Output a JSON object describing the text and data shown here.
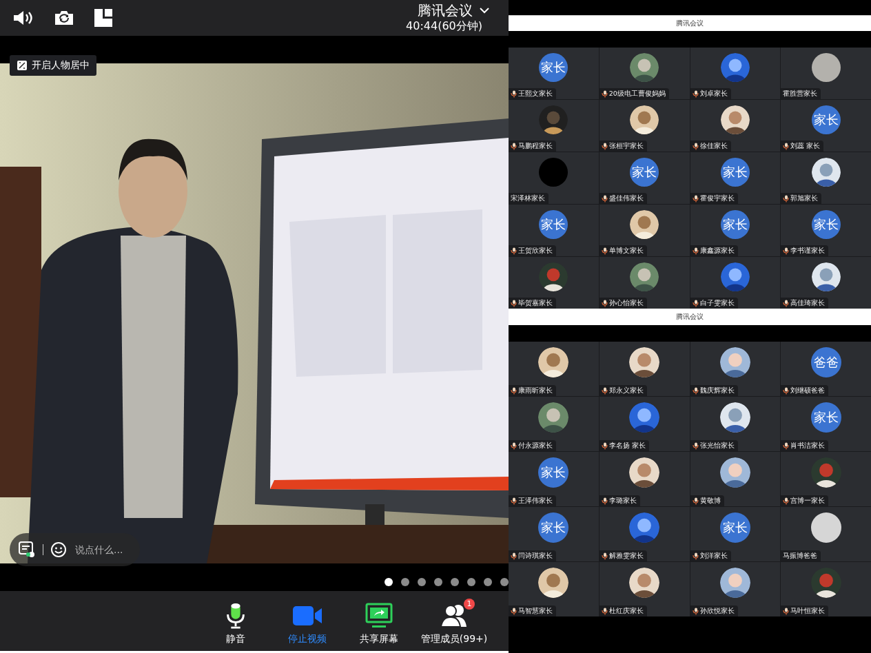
{
  "meeting": {
    "title": "腾讯会议",
    "timer": "40:44(60分钟)"
  },
  "video": {
    "kind": "picture",
    "center_button": "开启人物居中",
    "chat_placeholder": "说点什么...",
    "pages": [
      {
        "selected": true
      },
      {
        "selected": false
      },
      {
        "selected": false
      },
      {
        "selected": false
      },
      {
        "selected": false
      },
      {
        "selected": false
      },
      {
        "selected": false
      },
      {
        "selected": false
      }
    ]
  },
  "toolbar": [
    {
      "kind": "mic",
      "label": "静音",
      "highlighted": false
    },
    {
      "kind": "video",
      "label": "停止视频",
      "highlighted": true
    },
    {
      "kind": "share",
      "label": "共享屏幕",
      "highlighted": false
    },
    {
      "kind": "members",
      "label": "管理成员(99+)",
      "highlighted": false,
      "badge": "1"
    }
  ],
  "panels": [
    {
      "title": "腾讯会议",
      "participants": [
        {
          "name": "王熙文家长",
          "kind": "text",
          "avatar_text": "家长",
          "mic": true
        },
        {
          "name": "20级电工曹俊妈妈",
          "kind": "picture",
          "mic": true
        },
        {
          "name": "刘卓家长",
          "kind": "picture",
          "mic": true
        },
        {
          "name": "霍胜营家长",
          "kind": "blank",
          "color": "#b3b1ac",
          "mic": false
        },
        {
          "name": "马鹏程家长",
          "kind": "picture",
          "mic": true
        },
        {
          "name": "张桓宇家长",
          "kind": "picture",
          "mic": true
        },
        {
          "name": "徐佳家长",
          "kind": "picture",
          "mic": true
        },
        {
          "name": "刘蕊 家长",
          "kind": "text",
          "avatar_text": "家长",
          "mic": true
        },
        {
          "name": "宋泽林家长",
          "kind": "blank",
          "color": "#000000",
          "mic": false
        },
        {
          "name": "盛佳伟家长",
          "kind": "text",
          "avatar_text": "家长",
          "mic": true
        },
        {
          "name": "霍俊宇家长",
          "kind": "text",
          "avatar_text": "家长",
          "mic": true
        },
        {
          "name": "郭旭家长",
          "kind": "picture",
          "mic": true
        },
        {
          "name": "王贺欣家长",
          "kind": "text",
          "avatar_text": "家长",
          "mic": true
        },
        {
          "name": "单博文家长",
          "kind": "picture",
          "mic": true
        },
        {
          "name": "康鑫源家长",
          "kind": "text",
          "avatar_text": "家长",
          "mic": true
        },
        {
          "name": "李书谨家长",
          "kind": "text",
          "avatar_text": "家长",
          "mic": true
        },
        {
          "name": "毕贺嘉家长",
          "kind": "picture",
          "mic": true
        },
        {
          "name": "孙心怡家长",
          "kind": "picture",
          "mic": true
        },
        {
          "name": "白子雯家长",
          "kind": "picture",
          "mic": true
        },
        {
          "name": "高佳琦家长",
          "kind": "picture",
          "mic": true
        }
      ]
    },
    {
      "title": "腾讯会议",
      "participants": [
        {
          "name": "康雨昕家长",
          "kind": "picture",
          "mic": true
        },
        {
          "name": "郑永义家长",
          "kind": "picture",
          "mic": true
        },
        {
          "name": "魏庆辉家长",
          "kind": "picture",
          "mic": true
        },
        {
          "name": "刘继硕爸爸",
          "kind": "text",
          "avatar_text": "爸爸",
          "mic": true
        },
        {
          "name": "付永源家长",
          "kind": "picture",
          "mic": true
        },
        {
          "name": "李名扬 家长",
          "kind": "picture",
          "mic": true
        },
        {
          "name": "张光怡家长",
          "kind": "picture",
          "mic": true
        },
        {
          "name": "肖书洁家长",
          "kind": "text",
          "avatar_text": "家长",
          "mic": true
        },
        {
          "name": "王泽伟家长",
          "kind": "text",
          "avatar_text": "家长",
          "mic": true
        },
        {
          "name": "李璐家长",
          "kind": "picture",
          "mic": true
        },
        {
          "name": "黄敬博",
          "kind": "picture",
          "mic": true
        },
        {
          "name": "宫博一家长",
          "kind": "picture",
          "mic": true
        },
        {
          "name": "闫诗琪家长",
          "kind": "text",
          "avatar_text": "家长",
          "mic": true
        },
        {
          "name": "解雅雯家长",
          "kind": "picture",
          "mic": true
        },
        {
          "name": "刘洋家长",
          "kind": "text",
          "avatar_text": "家长",
          "mic": true
        },
        {
          "name": "马振博爸爸",
          "kind": "blank",
          "color": "#d6d6d6",
          "mic": false
        },
        {
          "name": "马智慧家长",
          "kind": "picture",
          "mic": true
        },
        {
          "name": "杜红庆家长",
          "kind": "picture",
          "mic": true
        },
        {
          "name": "孙欣悦家长",
          "kind": "picture",
          "mic": true
        },
        {
          "name": "马叶恒家长",
          "kind": "picture",
          "mic": true
        }
      ]
    }
  ]
}
